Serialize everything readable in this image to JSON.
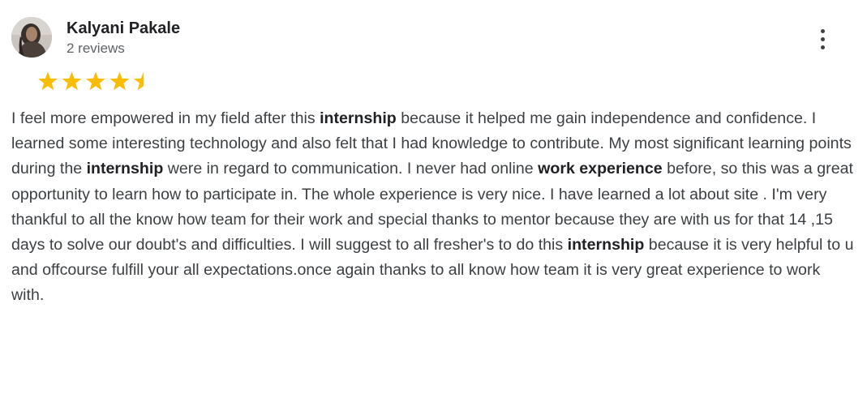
{
  "review": {
    "reviewer_name": "Kalyani Pakale",
    "review_count": "2 reviews",
    "rating": 4.5,
    "rating_max": 5,
    "avatar_icon": "user-photo-icon",
    "menu_icon": "more-vert-icon",
    "star_color": "#fbbc04",
    "text_segments": [
      {
        "text": "I feel more empowered in my field after this ",
        "bold": false
      },
      {
        "text": "internship",
        "bold": true
      },
      {
        "text": " because it helped me gain independence and confidence. I learned some interesting technology and also felt that I had knowledge to contribute. My most significant learning points during the ",
        "bold": false
      },
      {
        "text": "internship",
        "bold": true
      },
      {
        "text": " were in regard to communication. I never had online ",
        "bold": false
      },
      {
        "text": "work experience",
        "bold": true
      },
      {
        "text": " before, so this was a great opportunity to learn how to participate in. The whole experience is very nice. I have learned a lot about site . I'm very thankful to all the know how team for their work and special thanks to mentor because they are with us for that 14 ,15 days to solve our doubt's and difficulties. I will suggest to all fresher's to do this ",
        "bold": false
      },
      {
        "text": "internship",
        "bold": true
      },
      {
        "text": " because it is very helpful to u and offcourse fulfill your all expectations.once again thanks to all know how team it is very great experience to work with.",
        "bold": false
      }
    ]
  }
}
